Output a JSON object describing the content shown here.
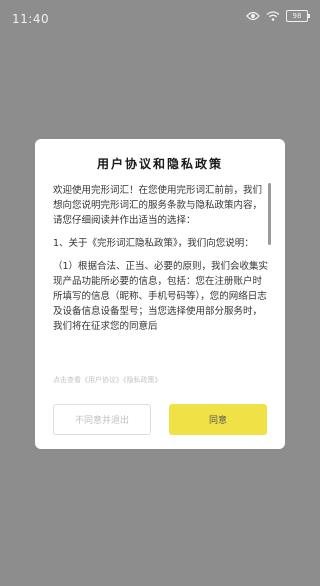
{
  "status_bar": {
    "time": "11:40",
    "battery": "98",
    "icons": [
      "eye-icon",
      "wifi-icon",
      "battery-icon"
    ]
  },
  "dialog": {
    "title": "用户协议和隐私政策",
    "paragraphs": [
      "欢迎使用完形词汇！在您使用完形词汇前前，我们想向您说明完形词汇的服务条款与隐私政策内容，请您仔细阅读并作出适当的选择：",
      "1、关于《完形词汇隐私政策》，我们向您说明：",
      "（1）根据合法、正当、必要的原则，我们会收集实现产品功能所必要的信息，包括：您在注册账户时所填写的信息（昵称、手机号码等），您的网络日志及设备信息设备型号；当您选择使用部分服务时，我们将在征求您的同意后"
    ],
    "footer_note": "点击查看《用户协议》《隐私政策》",
    "reject_label": "不同意并退出",
    "agree_label": "同意"
  },
  "colors": {
    "overlay": "#8d8d8d",
    "agree_button": "#f0e246"
  }
}
